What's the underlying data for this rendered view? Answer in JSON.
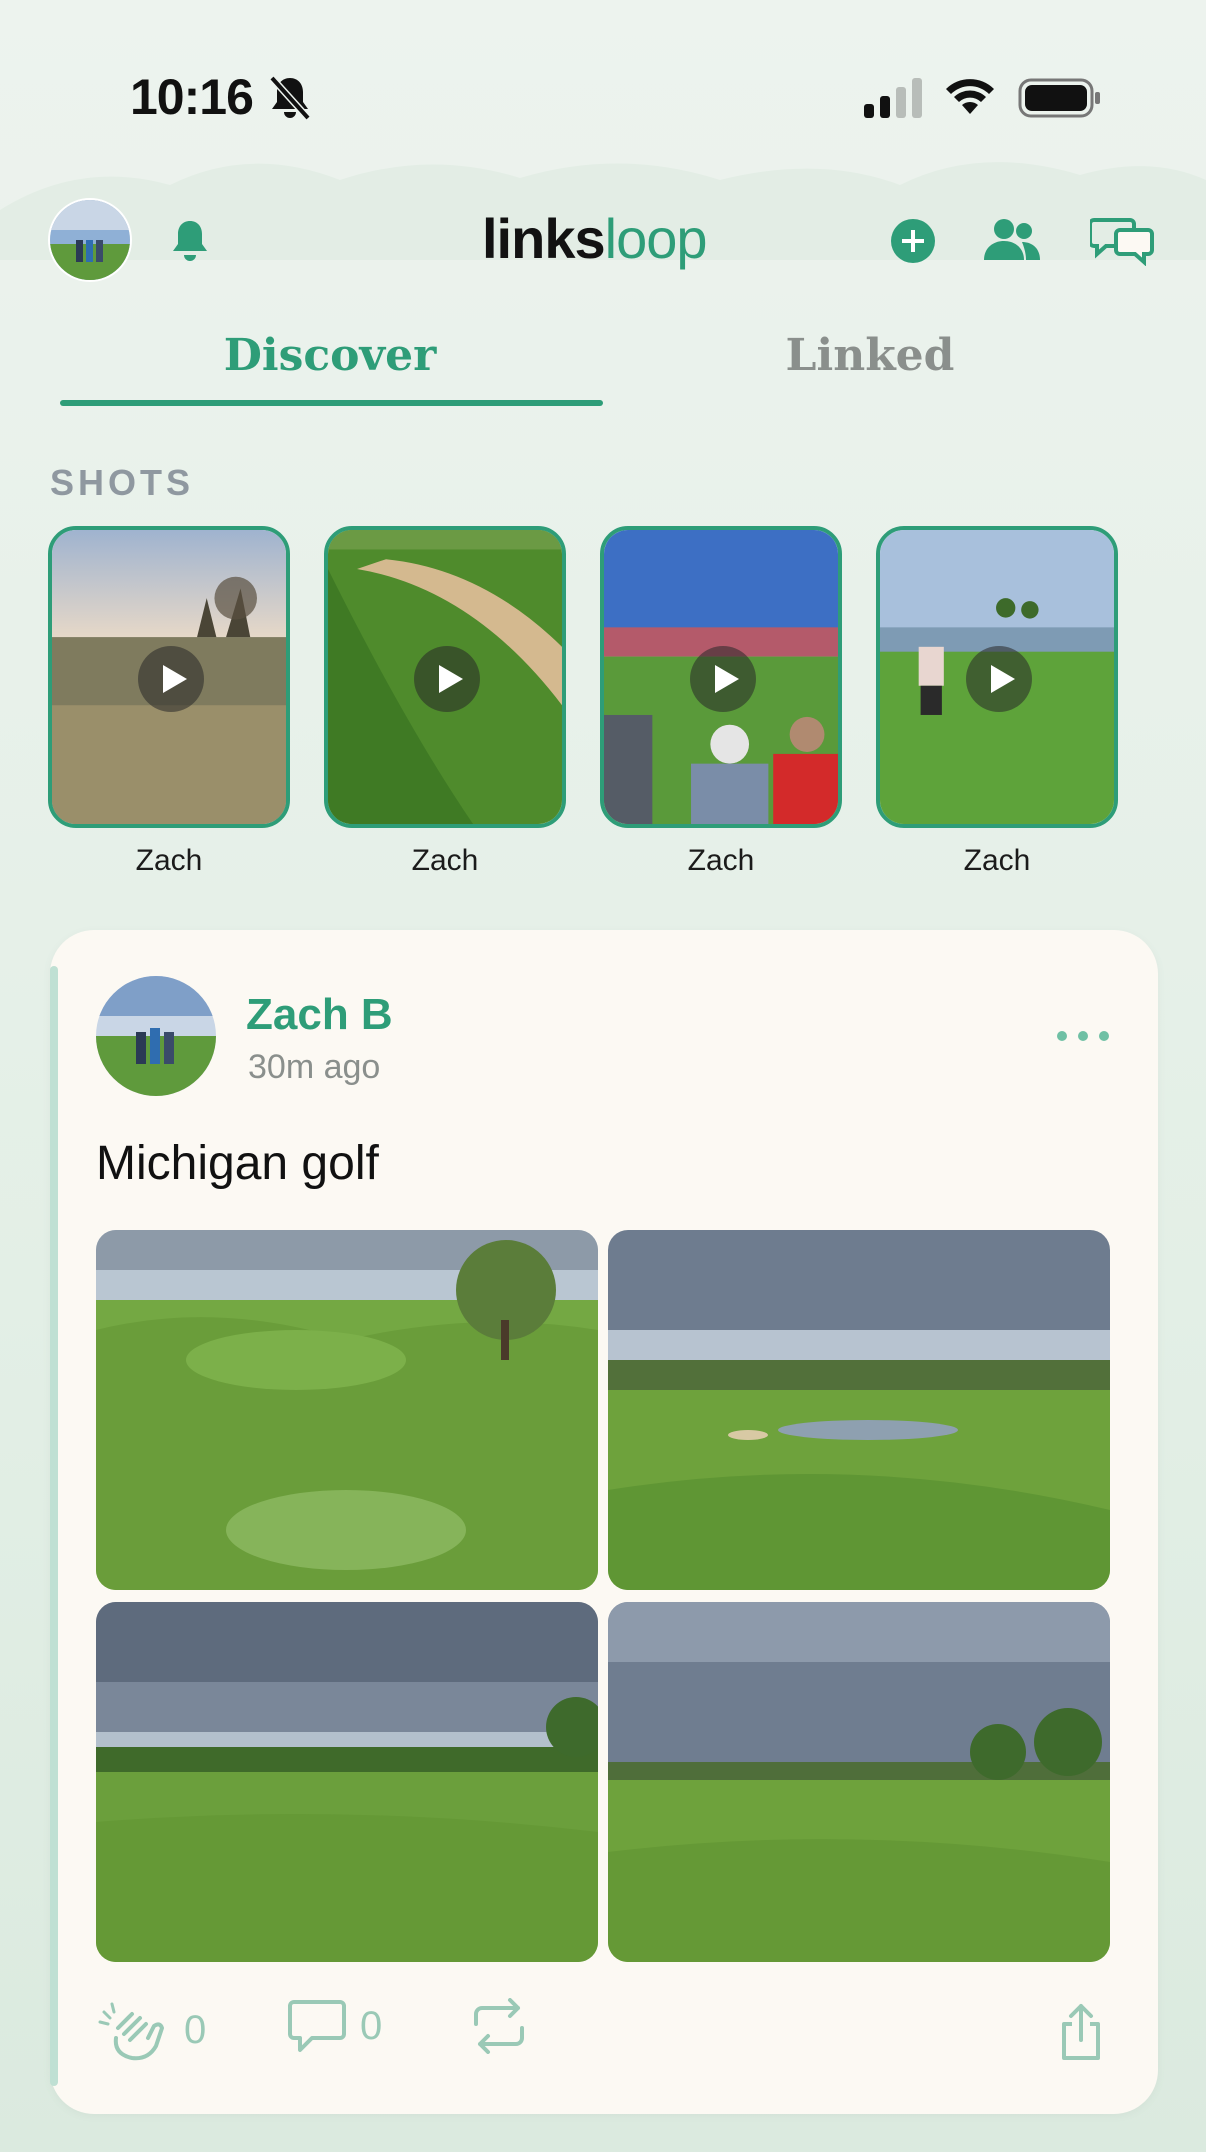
{
  "status_bar": {
    "time": "10:16"
  },
  "header": {
    "logo_part1": "links",
    "logo_part2": "loop",
    "icons": [
      "avatar",
      "bell-icon",
      "add-icon",
      "people-icon",
      "chat-icon"
    ]
  },
  "tabs": [
    {
      "label": "Discover",
      "active": true
    },
    {
      "label": "Linked",
      "active": false
    }
  ],
  "shots": {
    "label": "SHOTS",
    "items": [
      {
        "name": "Zach"
      },
      {
        "name": "Zach"
      },
      {
        "name": "Zach"
      },
      {
        "name": "Zach"
      }
    ]
  },
  "post": {
    "author": "Zach B",
    "time": "30m ago",
    "text": "Michigan golf",
    "claps": "0",
    "comments": "0"
  },
  "colors": {
    "accent": "#2e9d78",
    "card": "#fcf9f3",
    "background": "#e6f0e9"
  }
}
